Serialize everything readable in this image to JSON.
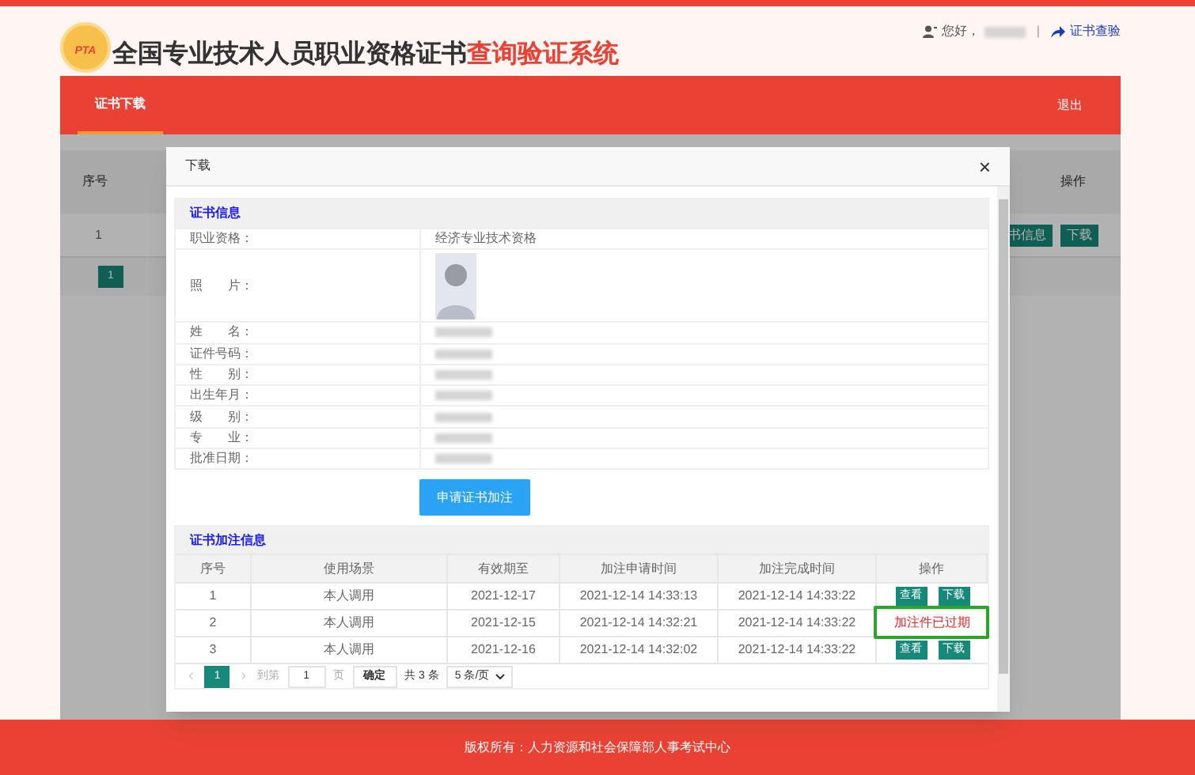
{
  "header": {
    "logo_text": "PTA",
    "title": "全国专业技术人员职业资格证书",
    "title_highlight": "查询验证系统",
    "greeting": "您好，",
    "username_redacted": true,
    "separator": "|",
    "verify_link": "证书查验"
  },
  "nav": {
    "tabs": [
      {
        "label": "证书下载",
        "selected": true
      }
    ],
    "logout": "退出"
  },
  "background_table": {
    "columns": [
      "序号",
      "操作"
    ],
    "rows": [
      {
        "cells": [
          "1"
        ],
        "actions": [
          "书信息",
          "下载"
        ]
      }
    ],
    "current_page": "1"
  },
  "modal": {
    "title": "下载",
    "close": "×",
    "cert_section": {
      "title": "证书信息",
      "rows": [
        {
          "label": "职业资格：",
          "kind": "text",
          "value": "经济专业技术资格"
        },
        {
          "label": "照　　片：",
          "kind": "photo"
        },
        {
          "label": "姓　　名：",
          "kind": "redacted"
        },
        {
          "label": "证件号码：",
          "kind": "redacted"
        },
        {
          "label": "性　　别：",
          "kind": "redacted"
        },
        {
          "label": "出生年月：",
          "kind": "redacted"
        },
        {
          "label": "级　　别：",
          "kind": "redacted"
        },
        {
          "label": "专　　业：",
          "kind": "redacted"
        },
        {
          "label": "批准日期：",
          "kind": "redacted"
        }
      ]
    },
    "apply_button": "申请证书加注",
    "annotation_section": {
      "title": "证书加注信息",
      "columns": [
        "序号",
        "使用场景",
        "有效期至",
        "加注申请时间",
        "加注完成时间",
        "操作"
      ],
      "rows": [
        {
          "cells": [
            "1",
            "本人调用",
            "2021-12-17",
            "2021-12-14 14:33:13",
            "2021-12-14 14:33:22"
          ],
          "kind": "actions",
          "actions": [
            "查看",
            "下载"
          ],
          "highlighted": false
        },
        {
          "cells": [
            "2",
            "本人调用",
            "2021-12-15",
            "2021-12-14 14:32:21",
            "2021-12-14 14:33:22"
          ],
          "kind": "expired",
          "status": "加注件已过期",
          "highlighted": true
        },
        {
          "cells": [
            "3",
            "本人调用",
            "2021-12-16",
            "2021-12-14 14:32:02",
            "2021-12-14 14:33:22"
          ],
          "kind": "actions",
          "actions": [
            "查看",
            "下载"
          ],
          "highlighted": false
        }
      ]
    },
    "pagination": {
      "prev": "‹",
      "pages": [
        {
          "label": "1",
          "selected": true
        }
      ],
      "next": "›",
      "goto_label": "到第",
      "goto_value": "1",
      "page_unit": "页",
      "confirm": "确定",
      "total": "共 3 条",
      "page_size": "5 条/页"
    }
  },
  "footer": "版权所有：人力资源和社会保障部人事考试中心"
}
